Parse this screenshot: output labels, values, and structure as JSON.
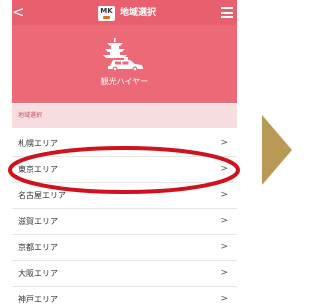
{
  "header": {
    "title": "地域選択",
    "logo_text": "MK",
    "back_icon": "chevron-left-icon",
    "menu_icon": "hamburger-menu-icon"
  },
  "hero": {
    "label": "観光ハイヤー",
    "icon": "pagoda-taxi-icon"
  },
  "section": {
    "label": "地域選択"
  },
  "regions": [
    {
      "label": "札幌エリア"
    },
    {
      "label": "東京エリア"
    },
    {
      "label": "名古屋エリア"
    },
    {
      "label": "滋賀エリア"
    },
    {
      "label": "京都エリア"
    },
    {
      "label": "大阪エリア"
    },
    {
      "label": "神戸エリア"
    }
  ],
  "chevron": ">",
  "colors": {
    "header_bg": "#e8606e",
    "hero_bg": "#ec6a78",
    "section_bg": "#f7dde0",
    "highlight_ellipse": "#d0121e",
    "arrow": "#b89a56"
  }
}
